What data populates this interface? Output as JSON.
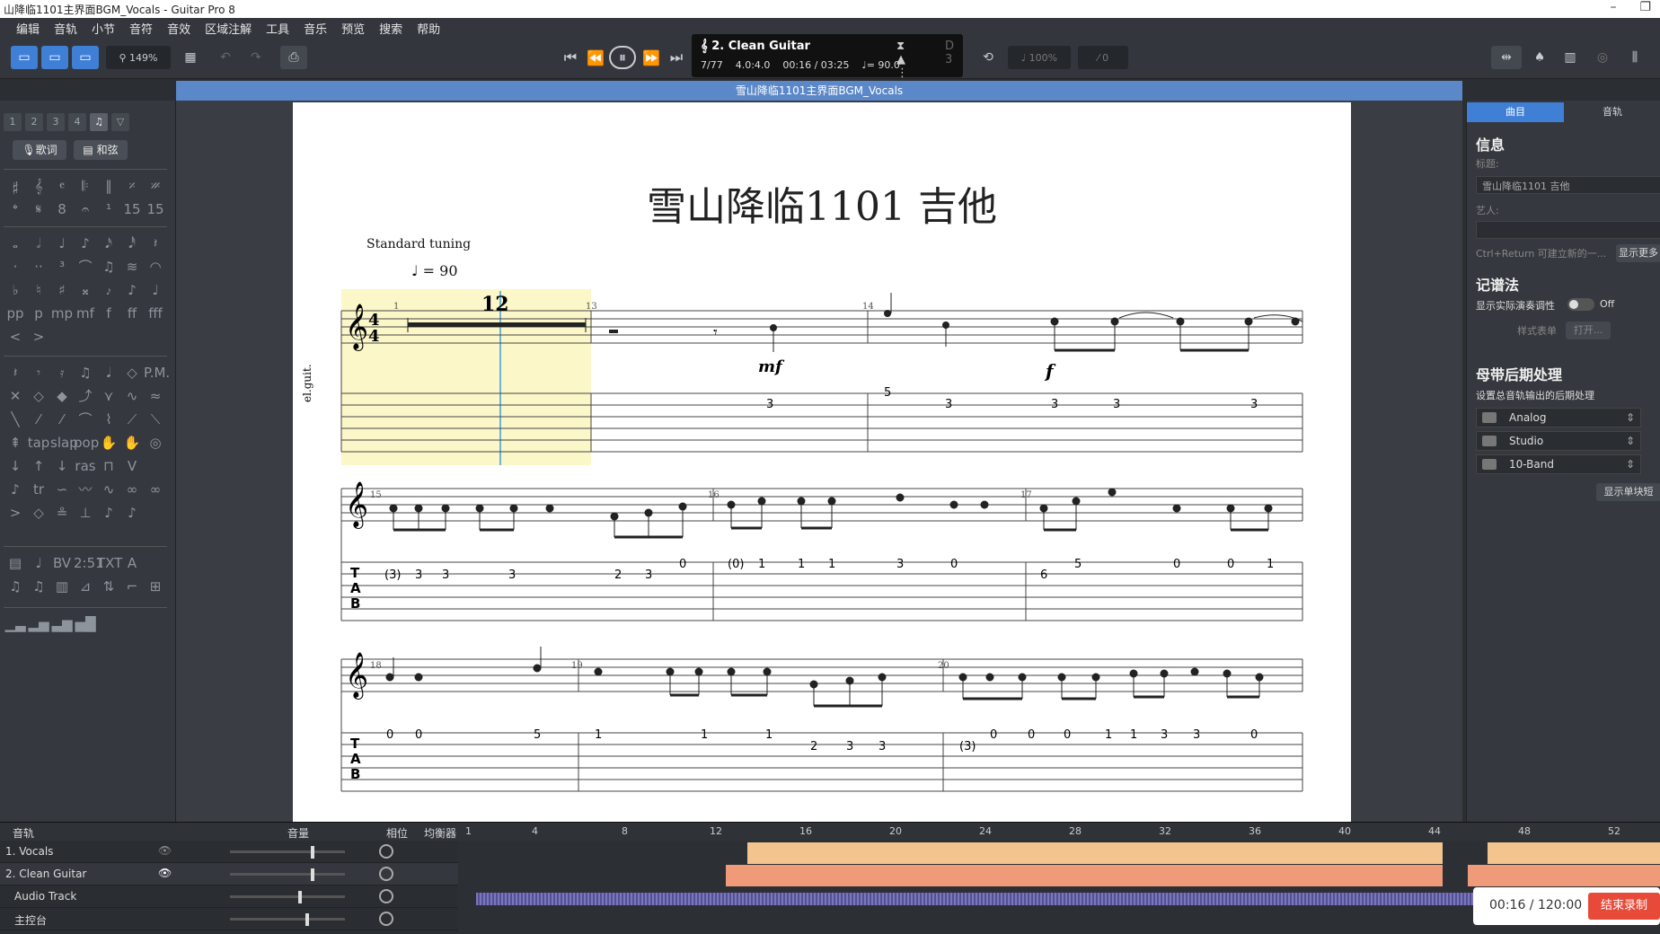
{
  "window": {
    "title": "山降临1101主界面BGM_Vocals - Guitar Pro 8"
  },
  "menu": [
    "编辑",
    "音轨",
    "小节",
    "音符",
    "音效",
    "区域注解",
    "工具",
    "音乐",
    "预览",
    "搜索",
    "帮助"
  ],
  "toolbar": {
    "zoom": "149%",
    "lcd_track": "2. Clean Guitar",
    "lcd_bar": "7/77",
    "lcd_sig": "4.0:4.0",
    "lcd_time": "00:16 / 03:25",
    "lcd_tempo": "♩= 90.0",
    "lcd_key": "D 3",
    "speed": "100%",
    "volume_val": "0"
  },
  "doc_tab": "雪山降临1101主界面BGM_Vocals",
  "left": {
    "lyrics_btn": "歌词",
    "chord_btn": "和弦",
    "pages": [
      "1",
      "2",
      "3",
      "4"
    ]
  },
  "score": {
    "title": "雪山降临1101 吉他",
    "tuning": "Standard tuning",
    "tempo": "= 90",
    "track_label": "el.guit.",
    "rest_count": "12",
    "dyn1": "mf",
    "dyn2": "f",
    "bar_numbers": [
      "1",
      "13",
      "14",
      "15",
      "16",
      "17",
      "18",
      "19",
      "20"
    ],
    "tab_row1": [
      "3",
      "5",
      "3",
      "3",
      "3",
      "3"
    ],
    "tab_row2": [
      "(3)",
      "3",
      "3",
      "3",
      "2",
      "3",
      "0",
      "(0)",
      "1",
      "1",
      "1",
      "3",
      "0",
      "6",
      "5",
      "0",
      "0",
      "1"
    ],
    "tab_row3": [
      "0",
      "0",
      "5",
      "1",
      "1",
      "1",
      "2",
      "3",
      "3",
      "(3)",
      "0",
      "0",
      "0",
      "1",
      "1",
      "3",
      "3",
      "0"
    ]
  },
  "right": {
    "tab_song": "曲目",
    "tab_track": "音轨",
    "info": "信息",
    "title_label": "标题:",
    "title_value": "雪山降临1101 吉他",
    "artist_label": "艺人:",
    "hint": "Ctrl+Return 可建立新的一...",
    "more_btn": "显示更多",
    "notation": "记谱法",
    "show_pitch": "显示实际演奏调性",
    "off": "Off",
    "style_label": "样式表单",
    "open_btn": "打开...",
    "master": "母带后期处理",
    "master_sub": "设置总音轨输出的后期处理",
    "fx": [
      "Analog",
      "Studio",
      "10-Band"
    ],
    "show_single": "显示单块短"
  },
  "tracks": {
    "header": {
      "tracks": "音轨",
      "volume": "音量",
      "pan": "相位",
      "eq": "均衡器"
    },
    "rows": [
      {
        "name": "1. Vocals"
      },
      {
        "name": "2. Clean Guitar"
      },
      {
        "name": "Audio Track"
      },
      {
        "name": "主控台"
      }
    ],
    "ruler": [
      "1",
      "4",
      "8",
      "12",
      "16",
      "20",
      "24",
      "28",
      "32",
      "36",
      "40",
      "44",
      "48",
      "52"
    ]
  },
  "recording": {
    "time": "00:16 / 120:00",
    "stop": "结束录制"
  },
  "colors": {
    "accent": "#3f7fd6",
    "clip_vocal": "#f3c48e",
    "clip_guitar": "#ef9a78",
    "selection": "#fbf7c8"
  }
}
